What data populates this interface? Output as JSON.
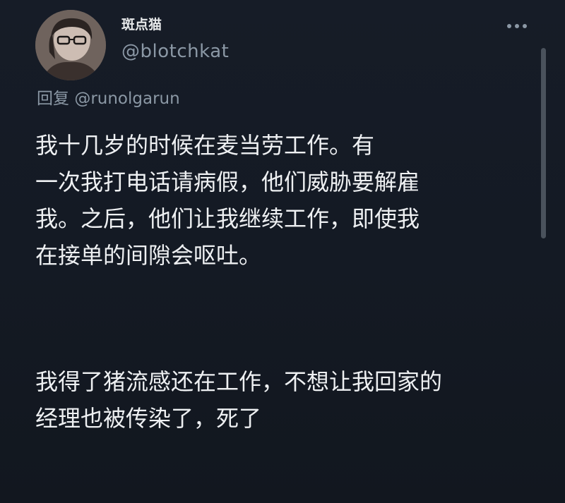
{
  "author": {
    "display_name": "斑点猫",
    "handle": "@blotchkat",
    "avatar_icon": "user-avatar-photo"
  },
  "reply": {
    "prefix": "回复",
    "mention": "@runolgarun"
  },
  "menu": {
    "icon": "more-horizontal-icon"
  },
  "tweet": {
    "para1_lines": [
      "我十几岁的时候在麦当劳工作。有",
      "一次我打电话请病假，他们威胁要解雇",
      "我。之后，他们让我继续工作，即使我",
      "在接单的间隙会呕吐。"
    ],
    "para2_lines": [
      "我得了猪流感还在工作，不想让我回家的",
      "经理也被传染了，死了"
    ]
  },
  "colors": {
    "background": "#151b26",
    "primary_text": "#e7e9ea",
    "secondary_text": "#8b98a5"
  }
}
